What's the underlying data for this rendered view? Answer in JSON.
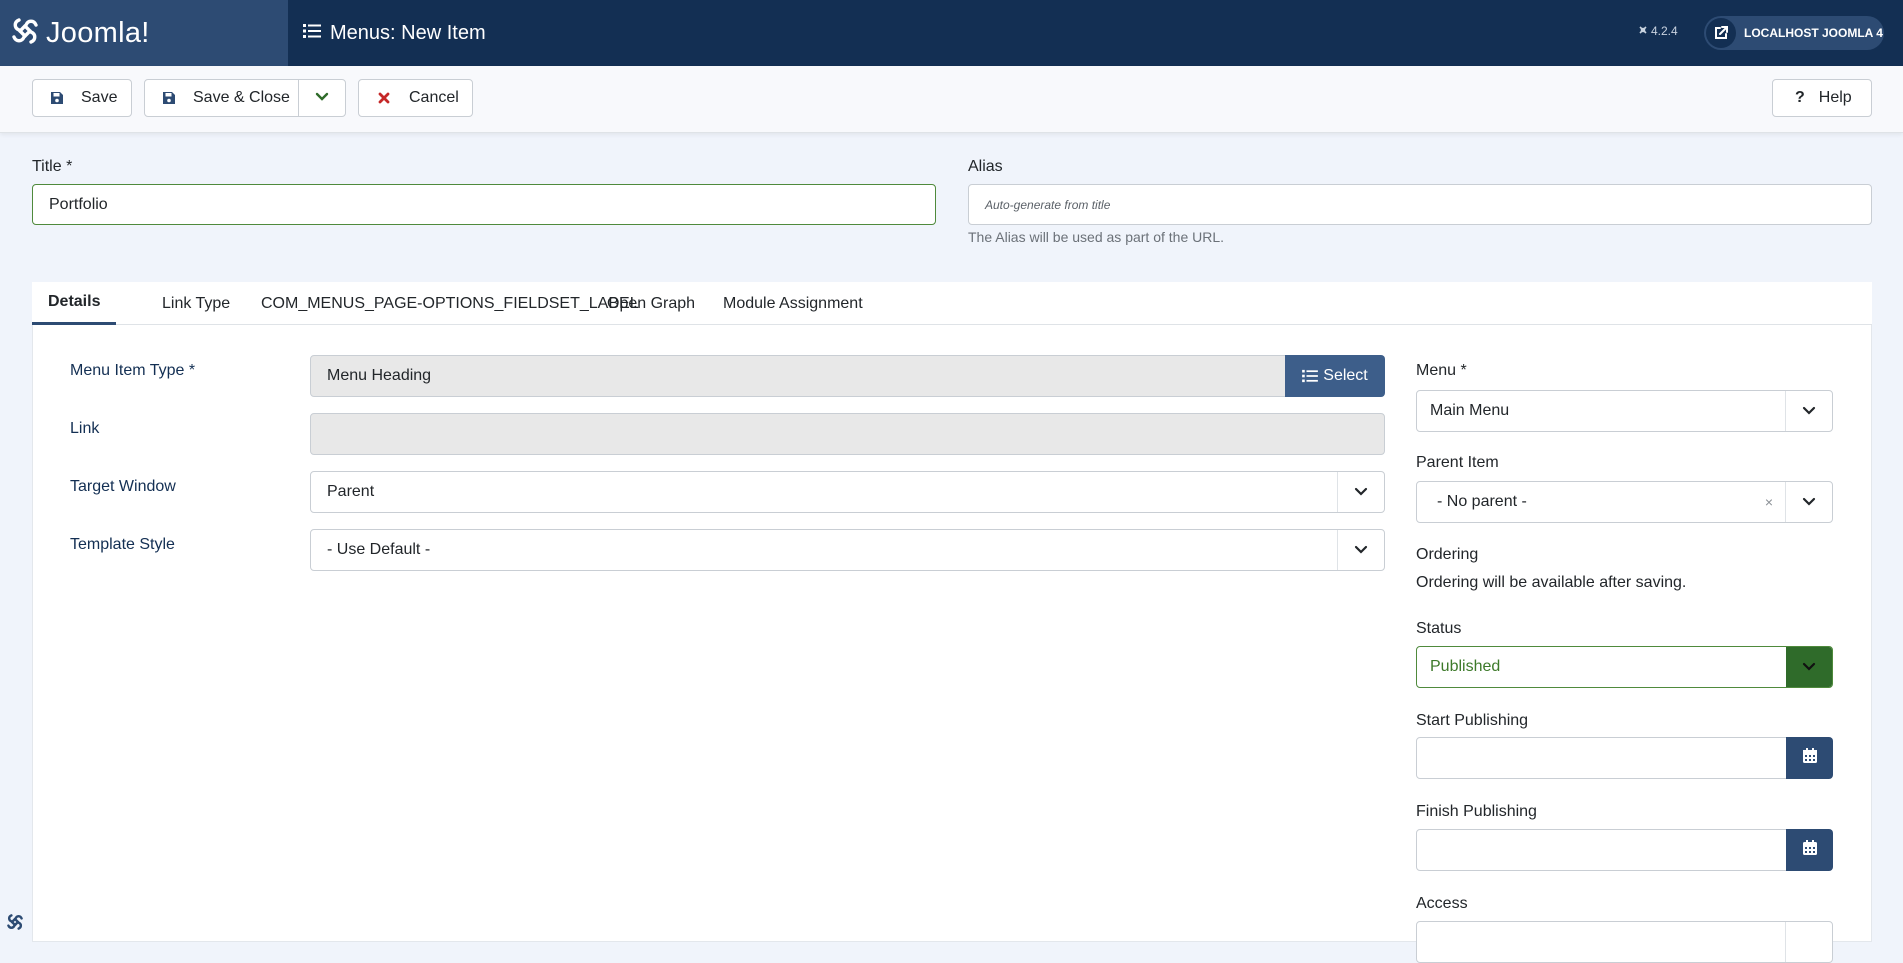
{
  "header": {
    "logo_text": "Joomla!",
    "page_title": "Menus: New Item",
    "version": "4.2.4",
    "site_button": "LOCALHOST JOOMLA 4"
  },
  "toolbar": {
    "save": "Save",
    "save_close": "Save & Close",
    "cancel": "Cancel",
    "help": "Help"
  },
  "form": {
    "title_label": "Title *",
    "title_value": "Portfolio",
    "alias_label": "Alias",
    "alias_placeholder": "Auto-generate from title",
    "alias_hint": "The Alias will be used as part of the URL."
  },
  "tabs": [
    "Details",
    "Link Type",
    "COM_MENUS_PAGE-OPTIONS_FIELDSET_LABEL",
    "Open Graph",
    "Module Assignment"
  ],
  "details": {
    "menu_item_type_label": "Menu Item Type *",
    "menu_item_type_value": "Menu Heading",
    "select_button": "Select",
    "link_label": "Link",
    "link_value": "",
    "target_window_label": "Target Window",
    "target_window_value": "Parent",
    "template_style_label": "Template Style",
    "template_style_value": "- Use Default -"
  },
  "sidebar": {
    "menu_label": "Menu *",
    "menu_value": "Main Menu",
    "parent_label": "Parent Item",
    "parent_value": "- No parent -",
    "ordering_label": "Ordering",
    "ordering_note": "Ordering will be available after saving.",
    "status_label": "Status",
    "status_value": "Published",
    "start_publishing_label": "Start Publishing",
    "finish_publishing_label": "Finish Publishing",
    "access_label": "Access"
  },
  "colors": {
    "header_bg": "#132f53",
    "brand_bg": "#2d4b73",
    "success": "#2f6b2a",
    "danger": "#c52828"
  }
}
